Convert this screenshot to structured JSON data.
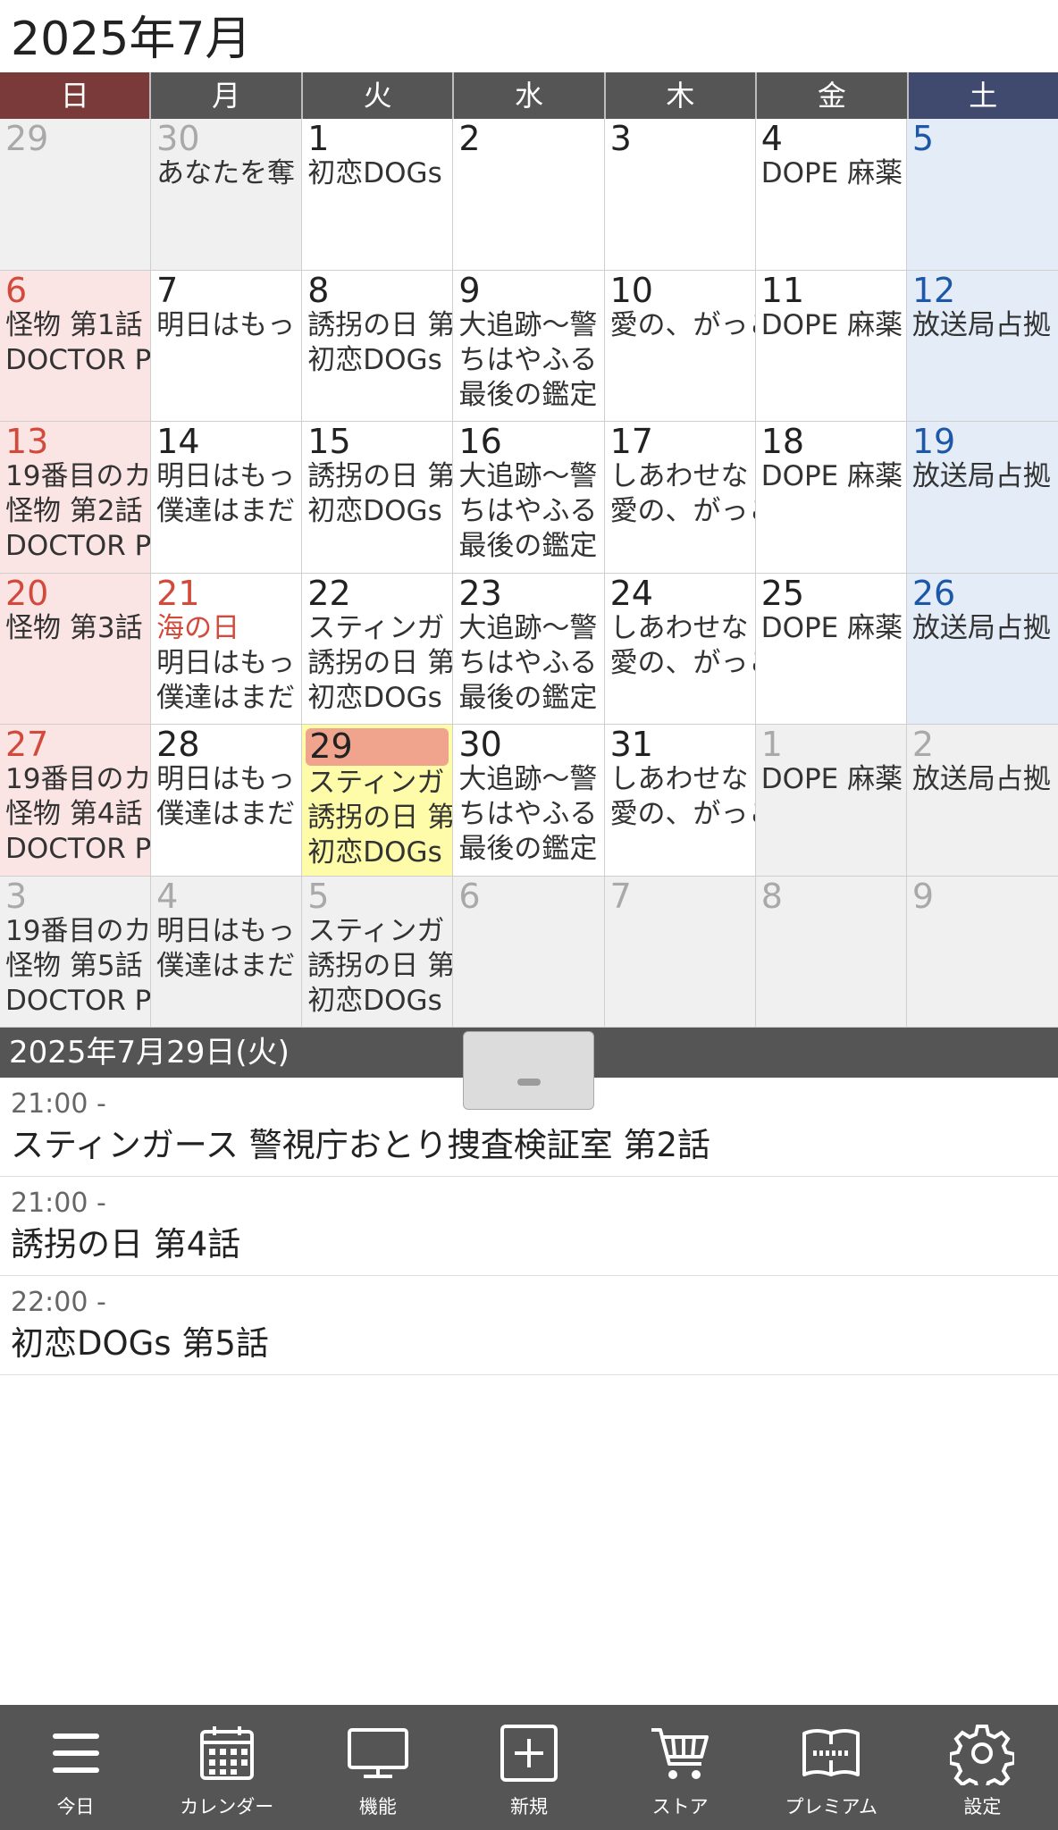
{
  "header": {
    "title": "2025年7月"
  },
  "weekdays": [
    "日",
    "月",
    "火",
    "水",
    "木",
    "金",
    "土"
  ],
  "calendar": {
    "days": [
      {
        "num": "29",
        "state": "out",
        "events": []
      },
      {
        "num": "30",
        "state": "out",
        "events": [
          "あなたを奪"
        ]
      },
      {
        "num": "1",
        "state": "",
        "events": [
          "初恋DOGs"
        ]
      },
      {
        "num": "2",
        "state": "",
        "events": []
      },
      {
        "num": "3",
        "state": "",
        "events": []
      },
      {
        "num": "4",
        "state": "",
        "events": [
          "DOPE 麻薬"
        ]
      },
      {
        "num": "5",
        "state": "sat",
        "events": []
      },
      {
        "num": "6",
        "state": "sun",
        "events": [
          "怪物 第1話",
          "DOCTOR P"
        ]
      },
      {
        "num": "7",
        "state": "",
        "events": [
          "明日はもっ"
        ]
      },
      {
        "num": "8",
        "state": "",
        "events": [
          "誘拐の日 第",
          "初恋DOGs"
        ]
      },
      {
        "num": "9",
        "state": "",
        "events": [
          "大追跡〜警",
          "ちはやふる",
          "最後の鑑定"
        ]
      },
      {
        "num": "10",
        "state": "",
        "events": [
          "愛の、がっこ"
        ]
      },
      {
        "num": "11",
        "state": "",
        "events": [
          "DOPE 麻薬"
        ]
      },
      {
        "num": "12",
        "state": "sat",
        "events": [
          "放送局占拠"
        ]
      },
      {
        "num": "13",
        "state": "sun",
        "events": [
          "19番目のカ",
          "怪物 第2話",
          "DOCTOR P"
        ]
      },
      {
        "num": "14",
        "state": "",
        "events": [
          "明日はもっ",
          "僕達はまだ"
        ]
      },
      {
        "num": "15",
        "state": "",
        "events": [
          "誘拐の日 第",
          "初恋DOGs"
        ]
      },
      {
        "num": "16",
        "state": "",
        "events": [
          "大追跡〜警",
          "ちはやふる",
          "最後の鑑定"
        ]
      },
      {
        "num": "17",
        "state": "",
        "events": [
          "しあわせな",
          "愛の、がっこ"
        ]
      },
      {
        "num": "18",
        "state": "",
        "events": [
          "DOPE 麻薬"
        ]
      },
      {
        "num": "19",
        "state": "sat",
        "events": [
          "放送局占拠"
        ]
      },
      {
        "num": "20",
        "state": "sun",
        "events": [
          "怪物 第3話"
        ]
      },
      {
        "num": "21",
        "state": "holiday",
        "events": [
          "海の日",
          "明日はもっ",
          "僕達はまだ"
        ],
        "holiday_event": true
      },
      {
        "num": "22",
        "state": "",
        "events": [
          "スティンガ",
          "誘拐の日 第",
          "初恋DOGs"
        ]
      },
      {
        "num": "23",
        "state": "",
        "events": [
          "大追跡〜警",
          "ちはやふる",
          "最後の鑑定"
        ]
      },
      {
        "num": "24",
        "state": "",
        "events": [
          "しあわせな",
          "愛の、がっこ"
        ]
      },
      {
        "num": "25",
        "state": "",
        "events": [
          "DOPE 麻薬"
        ]
      },
      {
        "num": "26",
        "state": "sat",
        "events": [
          "放送局占拠"
        ]
      },
      {
        "num": "27",
        "state": "sun",
        "events": [
          "19番目のカ",
          "怪物 第4話",
          "DOCTOR P"
        ]
      },
      {
        "num": "28",
        "state": "",
        "events": [
          "明日はもっ",
          "僕達はまだ"
        ]
      },
      {
        "num": "29",
        "state": "today",
        "events": [
          "スティンガ",
          "誘拐の日 第",
          "初恋DOGs"
        ]
      },
      {
        "num": "30",
        "state": "",
        "events": [
          "大追跡〜警",
          "ちはやふる",
          "最後の鑑定"
        ]
      },
      {
        "num": "31",
        "state": "",
        "events": [
          "しあわせな",
          "愛の、がっこ"
        ]
      },
      {
        "num": "1",
        "state": "out",
        "events": [
          "DOPE 麻薬"
        ]
      },
      {
        "num": "2",
        "state": "out",
        "events": [
          "放送局占拠"
        ]
      },
      {
        "num": "3",
        "state": "out",
        "events": [
          "19番目のカ",
          "怪物 第5話",
          "DOCTOR P"
        ]
      },
      {
        "num": "4",
        "state": "out",
        "events": [
          "明日はもっ",
          "僕達はまだ"
        ]
      },
      {
        "num": "5",
        "state": "out",
        "events": [
          "スティンガ",
          "誘拐の日 第",
          "初恋DOGs"
        ]
      },
      {
        "num": "6",
        "state": "out",
        "events": []
      },
      {
        "num": "7",
        "state": "out",
        "events": []
      },
      {
        "num": "8",
        "state": "out",
        "events": []
      },
      {
        "num": "9",
        "state": "out",
        "events": []
      }
    ]
  },
  "detail": {
    "date": "2025年7月29日(火)",
    "events": [
      {
        "time": "21:00 -",
        "title": "スティンガース 警視庁おとり捜査検証室 第2話"
      },
      {
        "time": "21:00 -",
        "title": "誘拐の日 第4話"
      },
      {
        "time": "22:00 -",
        "title": "初恋DOGs 第5話"
      }
    ]
  },
  "nav": {
    "items": [
      {
        "label": "今日",
        "icon": "menu-icon"
      },
      {
        "label": "カレンダー",
        "icon": "calendar-icon"
      },
      {
        "label": "機能",
        "icon": "monitor-icon"
      },
      {
        "label": "新規",
        "icon": "add-icon"
      },
      {
        "label": "ストア",
        "icon": "cart-icon"
      },
      {
        "label": "プレミアム",
        "icon": "jorte-book-icon"
      },
      {
        "label": "設定",
        "icon": "gear-icon"
      }
    ]
  },
  "colors": {
    "header_dark": "#555555",
    "sunday_header": "#7a3a3a",
    "saturday_header": "#404a6e",
    "sunday_cell": "#fbe4e4",
    "saturday_cell": "#e4ecf8",
    "today_highlight": "#fefca9",
    "today_number_bg": "#f0a48e",
    "holiday_red": "#d24a3c",
    "saturday_blue": "#1d57a8"
  }
}
